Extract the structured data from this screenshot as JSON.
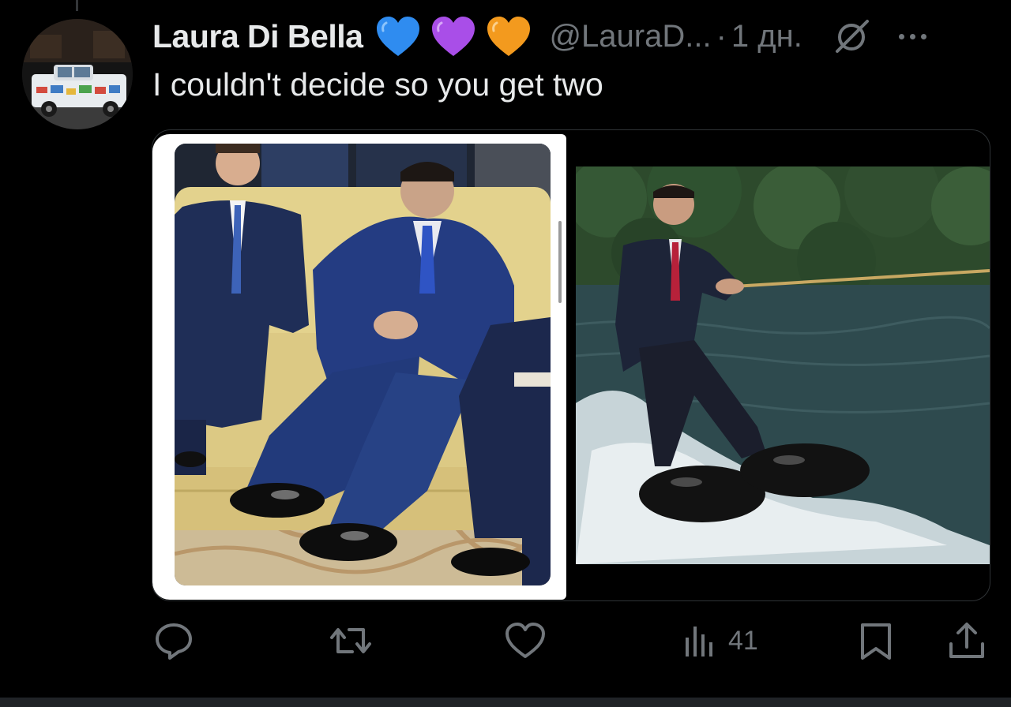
{
  "tweet": {
    "author": {
      "display_name": "Laura Di Bella",
      "emoji_badges": [
        "blue-heart",
        "purple-heart",
        "orange-heart"
      ],
      "handle": "@LauraD...",
      "separator": "·",
      "time_ago": "1 дн."
    },
    "text": "I couldn't decide so you get two",
    "media": [
      {
        "kind": "image",
        "subject": "man in oversized blue suit seated on yellow sofa"
      },
      {
        "kind": "image",
        "subject": "man in suit water-skiing on giant shoes"
      }
    ],
    "actions": {
      "reply_icon": "reply-icon",
      "repost_icon": "repost-icon",
      "like_icon": "like-icon",
      "views_icon": "views-icon",
      "views_count": "41",
      "bookmark_icon": "bookmark-icon",
      "share_icon": "share-icon"
    }
  },
  "colors": {
    "background": "#000000",
    "text_primary": "#e7e9ea",
    "text_secondary": "#71767b",
    "border": "#2f3336",
    "heart_blue": "#2f8cf0",
    "heart_purple": "#a94ee8",
    "heart_orange": "#f39a1e"
  }
}
